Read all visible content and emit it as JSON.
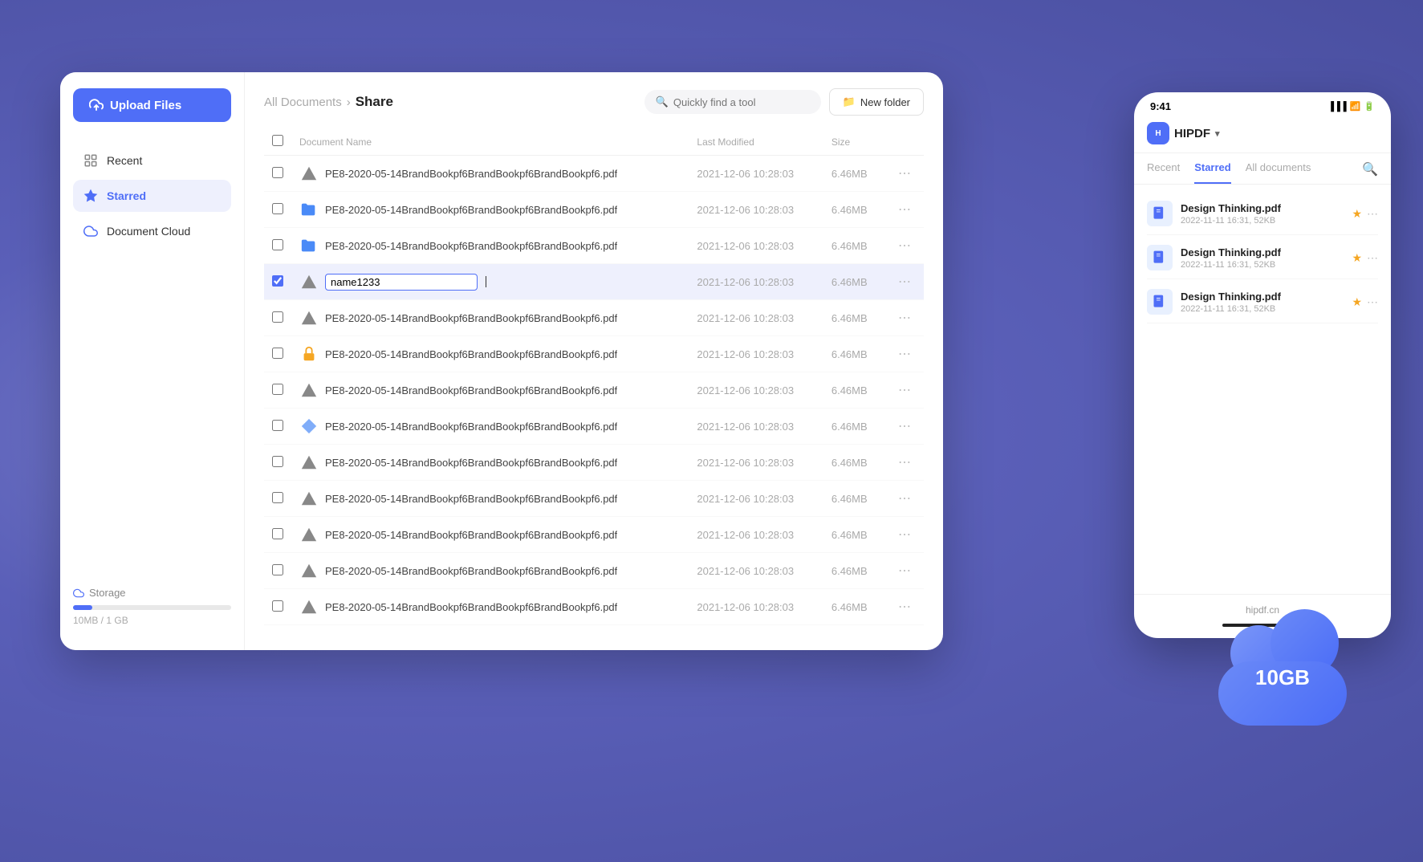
{
  "sidebar": {
    "upload_button_label": "Upload Files",
    "nav_items": [
      {
        "id": "recent",
        "label": "Recent",
        "active": false
      },
      {
        "id": "starred",
        "label": "Starred",
        "active": true
      },
      {
        "id": "document-cloud",
        "label": "Document Cloud",
        "active": false
      }
    ],
    "storage_label": "Storage",
    "storage_used": "10MB / 1 GB",
    "storage_pct": 12
  },
  "header": {
    "breadcrumb_parent": "All Documents",
    "breadcrumb_separator": "›",
    "breadcrumb_current": "Share",
    "search_placeholder": "Quickly find a tool",
    "new_folder_label": "New folder"
  },
  "table": {
    "columns": [
      "Document Name",
      "Last Modified",
      "Size"
    ],
    "rows": [
      {
        "name": "PE8-2020-05-14BrandBookpf6BrandBookpf6BrandBookpf6.pdf",
        "modified": "2021-12-06 10:28:03",
        "size": "6.46MB",
        "icon": "gray-triangle",
        "selected": false
      },
      {
        "name": "PE8-2020-05-14BrandBookpf6BrandBookpf6BrandBookpf6.pdf",
        "modified": "2021-12-06 10:28:03",
        "size": "6.46MB",
        "icon": "blue-folder",
        "selected": false
      },
      {
        "name": "PE8-2020-05-14BrandBookpf6BrandBookpf6BrandBookpf6.pdf",
        "modified": "2021-12-06 10:28:03",
        "size": "6.46MB",
        "icon": "blue-folder",
        "selected": false
      },
      {
        "name": "name1233",
        "modified": "2021-12-06 10:28:03",
        "size": "6.46MB",
        "icon": "gray-triangle",
        "selected": true,
        "renaming": true
      },
      {
        "name": "PE8-2020-05-14BrandBookpf6BrandBookpf6BrandBookpf6.pdf",
        "modified": "2021-12-06 10:28:03",
        "size": "6.46MB",
        "icon": "gray-triangle",
        "selected": false
      },
      {
        "name": "PE8-2020-05-14BrandBookpf6BrandBookpf6BrandBookpf6.pdf",
        "modified": "2021-12-06 10:28:03",
        "size": "6.46MB",
        "icon": "lock-yellow",
        "selected": false
      },
      {
        "name": "PE8-2020-05-14BrandBookpf6BrandBookpf6BrandBookpf6.pdf",
        "modified": "2021-12-06 10:28:03",
        "size": "6.46MB",
        "icon": "gray-triangle",
        "selected": false
      },
      {
        "name": "PE8-2020-05-14BrandBookpf6BrandBookpf6BrandBookpf6.pdf",
        "modified": "2021-12-06 10:28:03",
        "size": "6.46MB",
        "icon": "diamond-blue",
        "selected": false
      },
      {
        "name": "PE8-2020-05-14BrandBookpf6BrandBookpf6BrandBookpf6.pdf",
        "modified": "2021-12-06 10:28:03",
        "size": "6.46MB",
        "icon": "gray-triangle",
        "selected": false
      },
      {
        "name": "PE8-2020-05-14BrandBookpf6BrandBookpf6BrandBookpf6.pdf",
        "modified": "2021-12-06 10:28:03",
        "size": "6.46MB",
        "icon": "gray-triangle",
        "selected": false
      },
      {
        "name": "PE8-2020-05-14BrandBookpf6BrandBookpf6BrandBookpf6.pdf",
        "modified": "2021-12-06 10:28:03",
        "size": "6.46MB",
        "icon": "gray-triangle",
        "selected": false
      },
      {
        "name": "PE8-2020-05-14BrandBookpf6BrandBookpf6BrandBookpf6.pdf",
        "modified": "2021-12-06 10:28:03",
        "size": "6.46MB",
        "icon": "gray-triangle",
        "selected": false
      },
      {
        "name": "PE8-2020-05-14BrandBookpf6BrandBookpf6BrandBookpf6.pdf",
        "modified": "2021-12-06 10:28:03",
        "size": "6.46MB",
        "icon": "gray-triangle",
        "selected": false
      }
    ]
  },
  "mobile": {
    "time": "9:41",
    "app_name": "HIPDF",
    "tabs": [
      {
        "label": "Recent",
        "active": false
      },
      {
        "label": "Starred",
        "active": true
      },
      {
        "label": "All documents",
        "active": false
      }
    ],
    "files": [
      {
        "name": "Design Thinking.pdf",
        "date": "2022-11-11 16:31, 52KB"
      },
      {
        "name": "Design Thinking.pdf",
        "date": "2022-11-11 16:31, 52KB"
      },
      {
        "name": "Design Thinking.pdf",
        "date": "2022-11-11 16:31, 52KB"
      }
    ],
    "cloud_label": "10GB",
    "website": "hipdf.cn"
  },
  "colors": {
    "accent": "#4f6ef7",
    "selected_row_bg": "#eef0fd",
    "sidebar_active_bg": "#eef0fd",
    "storage_bar": "#4f6ef7",
    "star": "#f5a623",
    "cloud_gradient_start": "#7b8cf8",
    "cloud_gradient_end": "#4a6cf7"
  }
}
